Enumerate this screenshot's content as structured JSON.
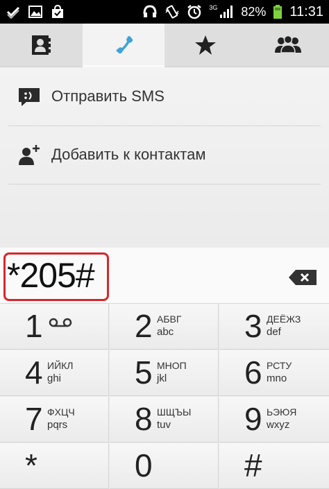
{
  "status_bar": {
    "network": "3G",
    "battery": "82%",
    "time": "11:31"
  },
  "tabs": [
    {
      "icon": "contacts-book-icon",
      "active": false
    },
    {
      "icon": "phone-icon",
      "active": true
    },
    {
      "icon": "star-icon",
      "active": false
    },
    {
      "icon": "groups-icon",
      "active": false
    }
  ],
  "actions": [
    {
      "icon": "sms-icon",
      "label": "Отправить SMS"
    },
    {
      "icon": "add-contact-icon",
      "label": "Добавить к контактам"
    }
  ],
  "dialer": {
    "number": "*205#"
  },
  "keypad": [
    {
      "digit": "1",
      "cyr": "",
      "lat": "",
      "icon": "voicemail-icon"
    },
    {
      "digit": "2",
      "cyr": "АБВГ",
      "lat": "abc"
    },
    {
      "digit": "3",
      "cyr": "ДЕЁЖЗ",
      "lat": "def"
    },
    {
      "digit": "4",
      "cyr": "ИЙКЛ",
      "lat": "ghi"
    },
    {
      "digit": "5",
      "cyr": "МНОП",
      "lat": "jkl"
    },
    {
      "digit": "6",
      "cyr": "РСТУ",
      "lat": "mno"
    },
    {
      "digit": "7",
      "cyr": "ФХЦЧ",
      "lat": "pqrs"
    },
    {
      "digit": "8",
      "cyr": "ШЩЪЫ",
      "lat": "tuv"
    },
    {
      "digit": "9",
      "cyr": "ЬЭЮЯ",
      "lat": "wxyz"
    },
    {
      "digit": "*",
      "cyr": "",
      "lat": ""
    },
    {
      "digit": "0",
      "cyr": "",
      "lat": ""
    },
    {
      "digit": "#",
      "cyr": "",
      "lat": ""
    }
  ],
  "colors": {
    "active_phone_icon": "#3fa3d8",
    "highlight_box": "#d7262b",
    "battery": "#7ed23e"
  }
}
